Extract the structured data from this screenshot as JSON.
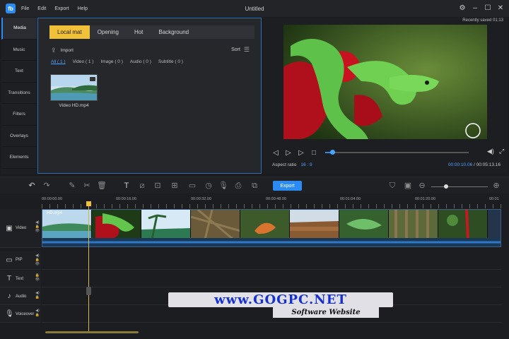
{
  "app": {
    "logo": "fb",
    "title": "Untitled",
    "menu": [
      "File",
      "Edit",
      "Export",
      "Help"
    ],
    "window_buttons": [
      "settings-icon",
      "minimize-icon",
      "maximize-icon",
      "close-icon"
    ]
  },
  "sidebar": {
    "items": [
      {
        "label": "Media",
        "active": true
      },
      {
        "label": "Music"
      },
      {
        "label": "Text"
      },
      {
        "label": "Transitions"
      },
      {
        "label": "Filters"
      },
      {
        "label": "Overlays"
      },
      {
        "label": "Elements"
      }
    ]
  },
  "media": {
    "tabs": [
      {
        "label": "Local mat",
        "active": true
      },
      {
        "label": "Opening"
      },
      {
        "label": "Hot"
      },
      {
        "label": "Background"
      }
    ],
    "import_label": "Import",
    "sort_label": "Sort",
    "filters": [
      {
        "label": "All ( 1 )",
        "active": true
      },
      {
        "label": "Video ( 1 )"
      },
      {
        "label": "Image ( 0 )"
      },
      {
        "label": "Audio ( 0 )"
      },
      {
        "label": "Subtitle ( 0 )"
      }
    ],
    "items": [
      {
        "name": "Video HD.mp4"
      }
    ]
  },
  "preview": {
    "saved": "Recently saved 01:13",
    "aspect_label": "Aspect ratio",
    "aspect_value": "16 : 9",
    "current_time": "00:00:10.06",
    "separator": "/",
    "total_time": "00:05:13.16",
    "progress": 0.03
  },
  "toolbar": {
    "export_label": "Export",
    "zoom_level": 0.25
  },
  "timeline": {
    "ruler": [
      "00:00:00.00",
      "00:00:16.00",
      "00:00:32.00",
      "00:00:48.00",
      "00:01:04.00",
      "00:01:20.00",
      "00:01"
    ],
    "tracks": [
      {
        "label": "Video",
        "icon": "video-track-icon"
      },
      {
        "label": "PIP",
        "icon": "pip-track-icon"
      },
      {
        "label": "Text",
        "icon": "text-track-icon"
      },
      {
        "label": "Audio",
        "icon": "music-note-icon"
      },
      {
        "label": "Voiceover",
        "icon": "microphone-icon"
      }
    ],
    "clip_name": "HD.mp4"
  },
  "watermark": {
    "main": "www.GOGPC.NET",
    "sub": "Software Website"
  }
}
